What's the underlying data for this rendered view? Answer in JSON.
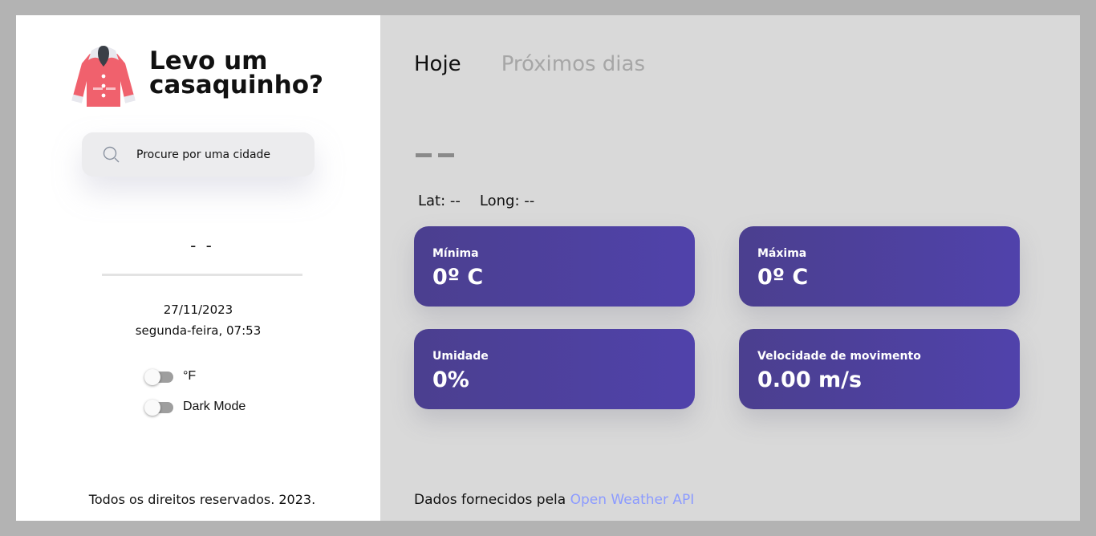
{
  "app": {
    "title": "Levo um casaquinho?",
    "logo_icon": "coat-icon"
  },
  "search": {
    "placeholder": "Procure por uma cidade",
    "value": "",
    "icon": "search-icon"
  },
  "location": {
    "city": "- -",
    "date": "27/11/2023",
    "day_time": "segunda-feira, 07:53"
  },
  "toggles": [
    {
      "label": "°F",
      "on": false
    },
    {
      "label": "Dark Mode",
      "on": false
    }
  ],
  "left_footer": "Todos os direitos reservados. 2023.",
  "tabs": [
    {
      "label": "Hoje",
      "active": true
    },
    {
      "label": "Próximos dias",
      "active": false
    }
  ],
  "coords": {
    "lat": "Lat: --",
    "long": "Long: --"
  },
  "cards": [
    {
      "label": "Mínima",
      "value": "0º C"
    },
    {
      "label": "Máxima",
      "value": "0º C"
    },
    {
      "label": "Umidade",
      "value": "0%"
    },
    {
      "label": "Velocidade de movimento",
      "value": "0.00 m/s"
    }
  ],
  "right_footer": {
    "text": "Dados fornecidos pela",
    "link": "Open Weather API"
  },
  "colors": {
    "card_start": "#4b3f8f",
    "card_end": "#5042ab",
    "link": "#8c9bff",
    "panel_right": "#d9d9d9",
    "coat": "#f0616d"
  }
}
